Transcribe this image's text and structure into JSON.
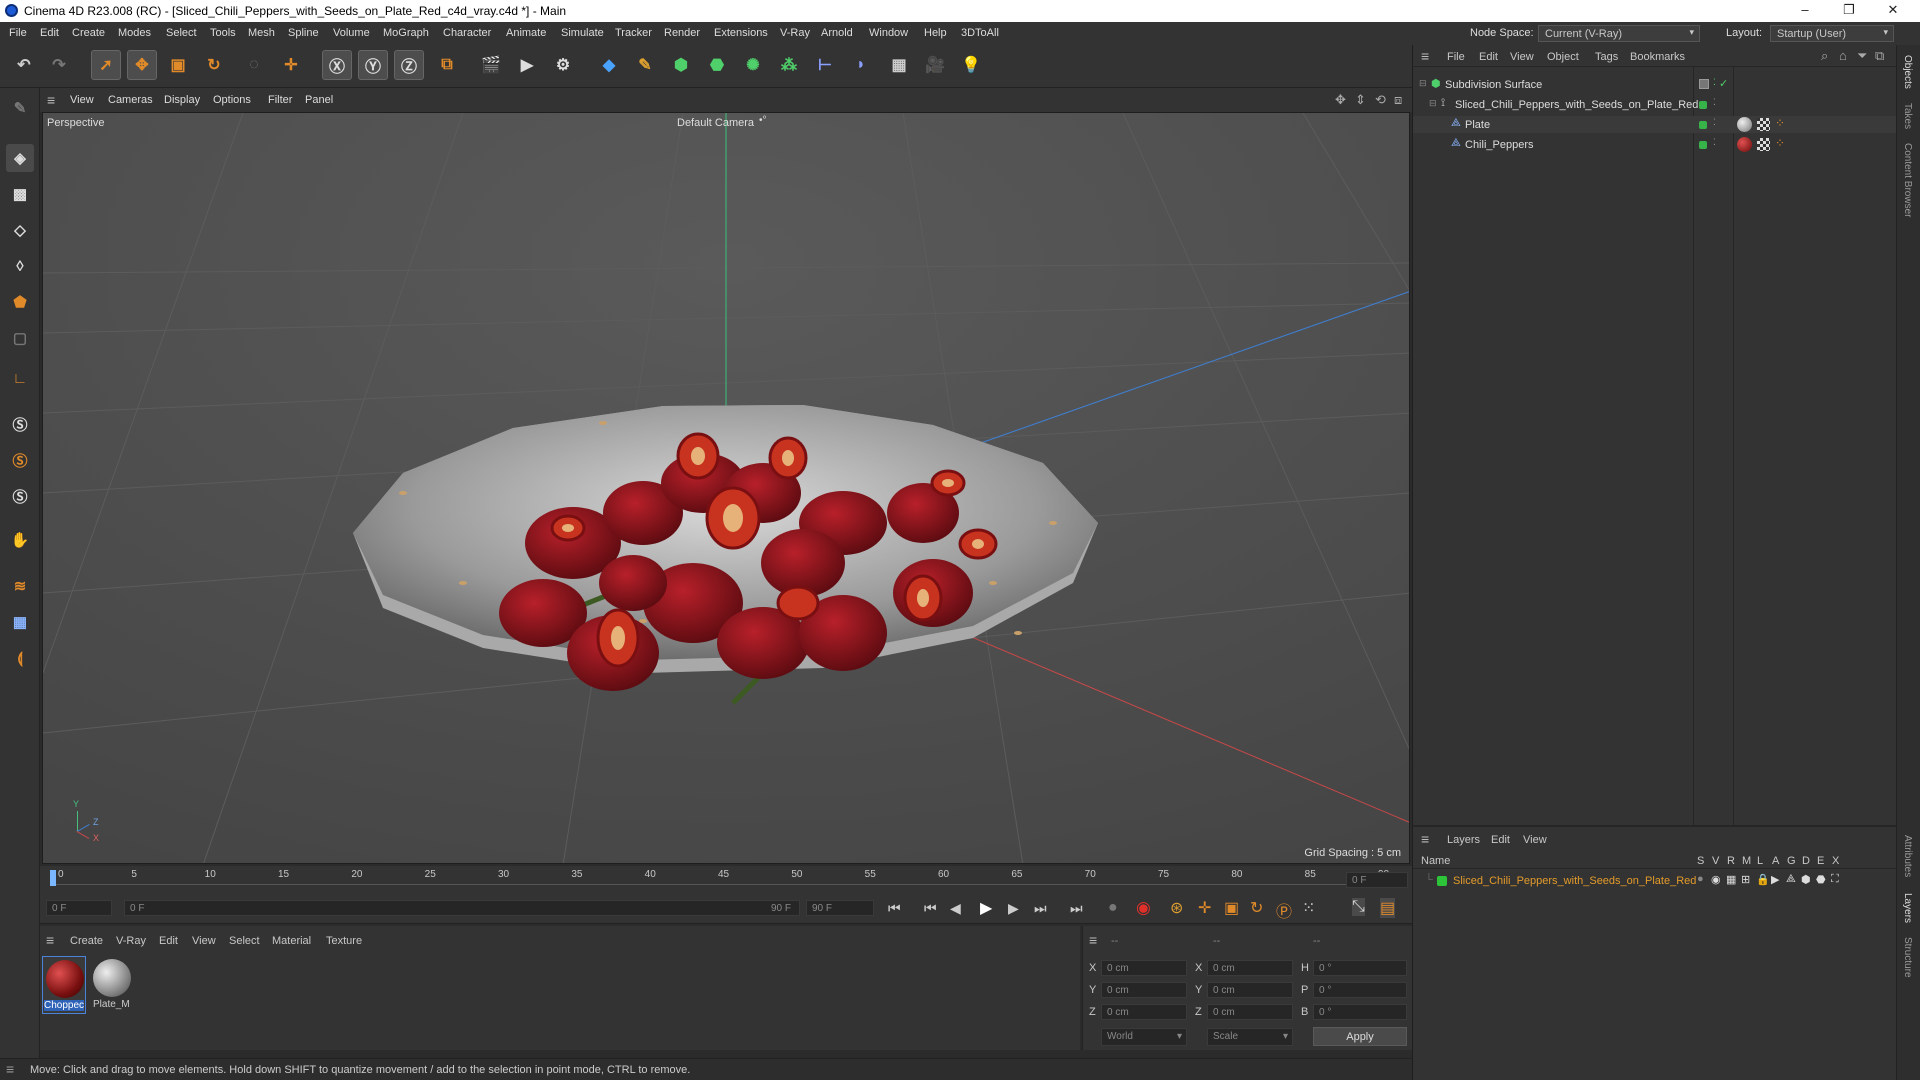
{
  "window": {
    "title": "Cinema 4D R23.008 (RC) - [Sliced_Chili_Peppers_with_Seeds_on_Plate_Red_c4d_vray.c4d *] - Main",
    "minimize": "–",
    "maximize": "❐",
    "close": "✕"
  },
  "menu": [
    "File",
    "Edit",
    "Create",
    "Modes",
    "Select",
    "Tools",
    "Mesh",
    "Spline",
    "Volume",
    "MoGraph",
    "Character",
    "Animate",
    "Simulate",
    "Tracker",
    "Render",
    "Extensions",
    "V-Ray",
    "Arnold",
    "Window",
    "Help",
    "3DToAll"
  ],
  "node_space": {
    "label": "Node Space:",
    "value": "Current (V-Ray)"
  },
  "layout": {
    "label": "Layout:",
    "value": "Startup (User)"
  },
  "viewport_menu": [
    "View",
    "Cameras",
    "Display",
    "Options",
    "Filter",
    "Panel"
  ],
  "viewport": {
    "name": "Perspective",
    "camera": "Default Camera",
    "camera_icon": "•°",
    "grid_spacing": "Grid Spacing : 5 cm",
    "axis_y": "Y",
    "axis_z": "Z",
    "axis_x": "X"
  },
  "timeline": {
    "ticks": [
      "0",
      "5",
      "10",
      "15",
      "20",
      "25",
      "30",
      "35",
      "40",
      "45",
      "50",
      "55",
      "60",
      "65",
      "70",
      "75",
      "80",
      "85",
      "90"
    ],
    "current_frame": "0 F"
  },
  "transport": {
    "start": "0 F",
    "range_start": "0 F",
    "range_end": "90 F",
    "end": "90 F"
  },
  "material_menu": [
    "Create",
    "V-Ray",
    "Edit",
    "View",
    "Select",
    "Material",
    "Texture"
  ],
  "materials": [
    {
      "name": "Choppec",
      "selected": true
    },
    {
      "name": "Plate_M",
      "selected": false
    }
  ],
  "coords": {
    "headers": [
      "--",
      "--",
      "--"
    ],
    "rows": [
      {
        "a": "X",
        "av": "0 cm",
        "b": "X",
        "bv": "0 cm",
        "c": "H",
        "cv": "0 °"
      },
      {
        "a": "Y",
        "av": "0 cm",
        "b": "Y",
        "bv": "0 cm",
        "c": "P",
        "cv": "0 °"
      },
      {
        "a": "Z",
        "av": "0 cm",
        "b": "Z",
        "bv": "0 cm",
        "c": "B",
        "cv": "0 °"
      }
    ],
    "space": "World",
    "mode": "Scale",
    "apply": "Apply"
  },
  "status": "Move: Click and drag to move elements. Hold down SHIFT to quantize movement / add to the selection in point mode, CTRL to remove.",
  "objects_menu": [
    "File",
    "Edit",
    "View",
    "Object",
    "Tags",
    "Bookmarks"
  ],
  "objects": [
    {
      "name": "Subdivision Surface",
      "indent": 0
    },
    {
      "name": "Sliced_Chili_Peppers_with_Seeds_on_Plate_Red",
      "indent": 1
    },
    {
      "name": "Plate",
      "indent": 2
    },
    {
      "name": "Chili_Peppers",
      "indent": 2
    }
  ],
  "layers_menu": [
    "Layers",
    "Edit",
    "View"
  ],
  "layers_header": {
    "name": "Name",
    "cols": [
      "S",
      "V",
      "R",
      "M",
      "L",
      "A",
      "G",
      "D",
      "E",
      "X"
    ]
  },
  "layers": [
    {
      "name": "Sliced_Chili_Peppers_with_Seeds_on_Plate_Red",
      "color": "#2ec43a"
    }
  ],
  "side_tabs_top": [
    "Objects",
    "Takes",
    "Content Browser"
  ],
  "side_tabs_bottom": [
    "Attributes",
    "Layers",
    "Structure"
  ],
  "colors": {
    "accent_orange": "#e08a2a",
    "green": "#38b34a",
    "layer_text": "#e39b2a"
  }
}
